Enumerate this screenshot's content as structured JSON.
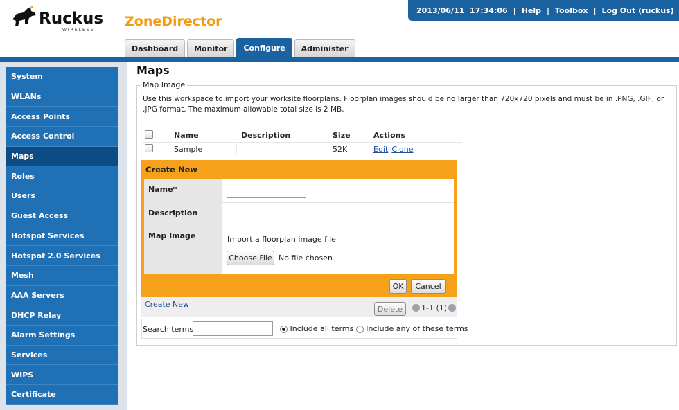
{
  "header": {
    "logo_text": "Ruckus",
    "logo_sub": "WIRELESS",
    "product": "ZoneDirector",
    "datetime": "2013/06/11  17:34:06",
    "help": "Help",
    "toolbox": "Toolbox",
    "logout": "Log Out (ruckus)",
    "separator": "|"
  },
  "tabs": [
    {
      "label": "Dashboard"
    },
    {
      "label": "Monitor"
    },
    {
      "label": "Configure"
    },
    {
      "label": "Administer"
    }
  ],
  "sidebar": {
    "active": "Maps",
    "items": [
      {
        "label": "System"
      },
      {
        "label": "WLANs"
      },
      {
        "label": "Access Points"
      },
      {
        "label": "Access Control"
      },
      {
        "label": "Maps"
      },
      {
        "label": "Roles"
      },
      {
        "label": "Users"
      },
      {
        "label": "Guest Access"
      },
      {
        "label": "Hotspot Services"
      },
      {
        "label": "Hotspot 2.0 Services"
      },
      {
        "label": "Mesh"
      },
      {
        "label": "AAA Servers"
      },
      {
        "label": "DHCP Relay"
      },
      {
        "label": "Alarm Settings"
      },
      {
        "label": "Services"
      },
      {
        "label": "WIPS"
      },
      {
        "label": "Certificate"
      }
    ]
  },
  "main": {
    "title": "Maps",
    "section_legend": "Map Image",
    "description": "Use this workspace to import your worksite floorplans. Floorplan images should be no larger than 720x720 pixels and must be in .PNG, .GIF, or .JPG format. The maximum allowable total size is 2 MB.",
    "table": {
      "columns": [
        "Name",
        "Description",
        "Size",
        "Actions"
      ],
      "rows": [
        {
          "name": "Sample",
          "description": "",
          "size": "52K",
          "edit": "Edit",
          "clone": "Clone"
        }
      ]
    },
    "create_new": {
      "title": "Create New",
      "name_label": "Name*",
      "description_label": "Description",
      "map_image_label": "Map Image",
      "import_text": "Import a floorplan image file",
      "choose_file": "Choose File",
      "no_file": "No file chosen",
      "ok": "OK",
      "cancel": "Cancel"
    },
    "footer": {
      "create_new_link": "Create New",
      "delete": "Delete",
      "pager": "1-1 (1)"
    },
    "search": {
      "label": "Search terms",
      "include_all": "Include all terms",
      "include_any": "Include any of these terms"
    }
  },
  "colors": {
    "accent_blue": "#1b62a0",
    "sidebar_blue": "#2070b6",
    "sidebar_active": "#0d4b85",
    "orange": "#f6a11a",
    "brand_orange": "#f29c0d"
  }
}
